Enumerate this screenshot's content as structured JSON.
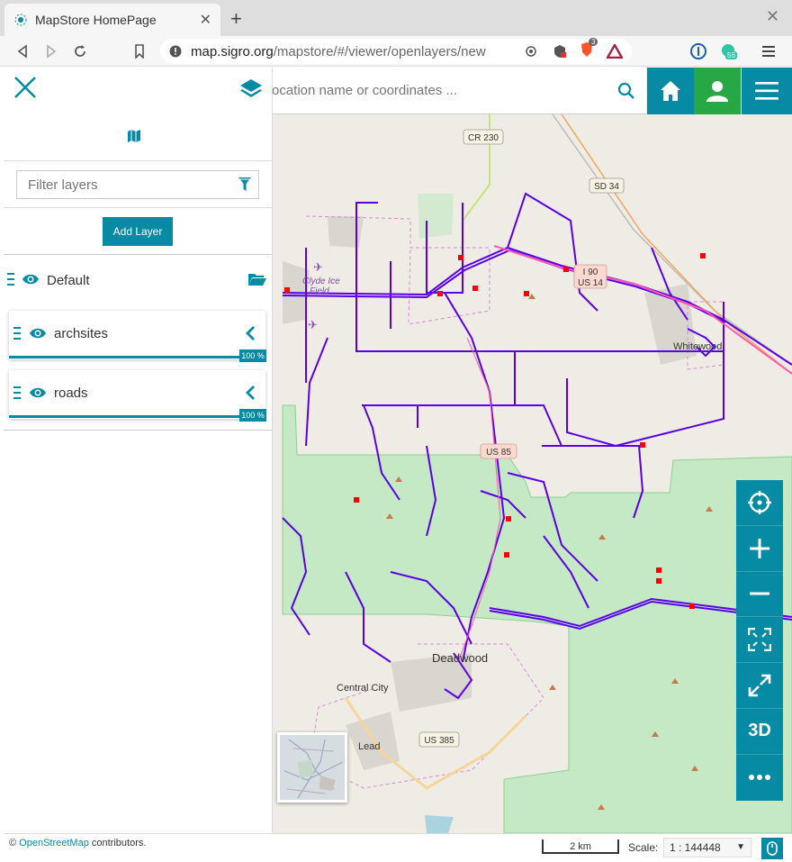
{
  "browser": {
    "tab_title": "MapStore HomePage",
    "url_host": "map.sigro.org",
    "url_path": "/mapstore/#/viewer/openlayers/new",
    "brave_badge": "3",
    "ext_badge": "56"
  },
  "search": {
    "placeholder": "ocation name or coordinates ..."
  },
  "panel": {
    "filter_placeholder": "Filter layers",
    "add_layer_label": "Add Layer",
    "group_name": "Default",
    "layers": [
      {
        "name": "archsites",
        "opacity": "100 %"
      },
      {
        "name": "roads",
        "opacity": "100 %"
      }
    ]
  },
  "map_labels": {
    "cr230": "CR 230",
    "sd34": "SD 34",
    "i90": "I 90",
    "us14": "US 14",
    "us85": "US 85",
    "us385": "US 385",
    "clyde": "Clyde Ice",
    "field": "Field",
    "whitewood": "Whitewood",
    "deadwood": "Deadwood",
    "central_city": "Central City",
    "lead": "Lead"
  },
  "toolbar": {
    "three_d_label": "3D"
  },
  "footer": {
    "attribution_prefix": "©",
    "attribution_link": "OpenStreetMap",
    "attribution_suffix": "contributors.",
    "scalebar_label": "2 km",
    "scale_label": "Scale:",
    "scale_value": "1 : 144448"
  },
  "colors": {
    "accent": "#078aa3",
    "user_button": "#28a745",
    "roads": "#5a00e8",
    "forest": "#c5e8c5",
    "archsite": "#ff0000"
  }
}
